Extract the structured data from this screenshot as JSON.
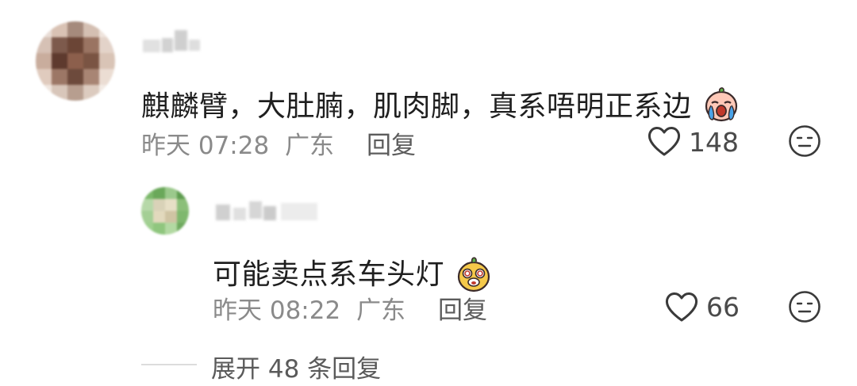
{
  "comments": [
    {
      "username": "",
      "text": "麒麟臂，大肚腩，肌肉脚，真系唔明正系边",
      "emoji": "crying-face-icon",
      "time": "昨天 07:28",
      "location": "广东",
      "reply_label": "回复",
      "likes": "148",
      "dislike_icon": "neutral-face-icon"
    }
  ],
  "replies": [
    {
      "username": "",
      "text": "可能卖点系车头灯",
      "emoji": "dizzy-face-icon",
      "time": "昨天 08:22",
      "location": "广东",
      "reply_label": "回复",
      "likes": "66",
      "dislike_icon": "neutral-face-icon"
    }
  ],
  "expand": {
    "label": "展开 48 条回复"
  },
  "colors": {
    "text": "#1f1f1f",
    "meta": "#8a8a8a",
    "icon": "#3a3a3a"
  }
}
